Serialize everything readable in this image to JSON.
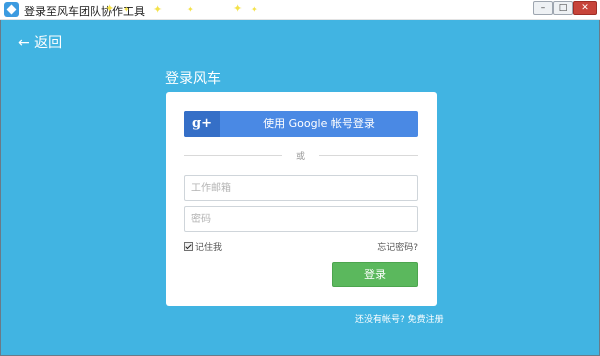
{
  "window": {
    "title": "登录至风车团队协作工具",
    "controls": {
      "minimize": "–",
      "maximize": "□",
      "close": "✕"
    }
  },
  "nav": {
    "back_label": "← 返回"
  },
  "login": {
    "heading": "登录风车",
    "google_icon": "g+",
    "google_label": "使用 Google 帐号登录",
    "divider_text": "或",
    "email_placeholder": "工作邮箱",
    "password_placeholder": "密码",
    "remember_label": "记住我",
    "remember_checked": true,
    "forgot_label": "忘记密码?",
    "submit_label": "登录"
  },
  "footer": {
    "no_account_text": "还没有帐号?",
    "signup_label": "免费注册"
  },
  "colors": {
    "background": "#41b4e2",
    "google_button": "#4a89e4",
    "google_icon_bg": "#356fc7",
    "login_button": "#5bb85d"
  }
}
